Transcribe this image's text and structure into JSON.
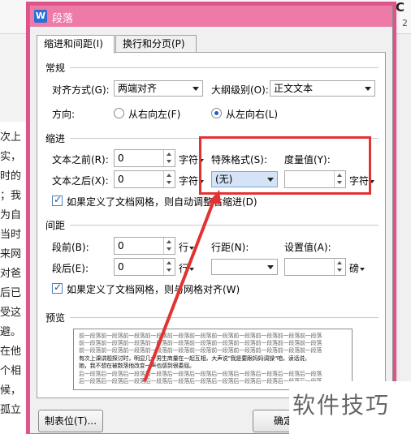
{
  "background": {
    "styles_text": "AaBbC",
    "number": "2",
    "doc_lines": [
      "次上",
      "实，",
      "时的",
      "；我",
      "为自",
      "当时",
      "来网",
      "对爸",
      "后已",
      "受这",
      "避。",
      "在他",
      "个相",
      "候，",
      "孤立"
    ]
  },
  "dialog": {
    "title": "段落",
    "title_icon": "W",
    "tabs": [
      {
        "label": "缩进和间距(I)",
        "active": true
      },
      {
        "label": "换行和分页(P)",
        "active": false
      }
    ],
    "general": {
      "heading": "常规",
      "alignment_label": "对齐方式(G):",
      "alignment_value": "两端对齐",
      "outline_label": "大纲级别(O):",
      "outline_value": "正文文本",
      "direction_label": "方向:",
      "rtl_label": "从右向左(F)",
      "ltr_label": "从左向右(L)",
      "direction_selected": "ltr"
    },
    "indent": {
      "heading": "缩进",
      "before_label": "文本之前(R):",
      "before_value": "0",
      "before_unit": "字符",
      "after_label": "文本之后(X):",
      "after_value": "0",
      "after_unit": "字符",
      "special_label": "特殊格式(S):",
      "special_value": "(无)",
      "measure_label": "度量值(Y):",
      "measure_value": "",
      "measure_unit": "字符",
      "grid_check_label": "如果定义了文档网格，则自动调整右缩进(D)",
      "grid_checked": true
    },
    "spacing": {
      "heading": "间距",
      "before_label": "段前(B):",
      "before_value": "0",
      "before_unit": "行",
      "after_label": "段后(E):",
      "after_value": "0",
      "after_unit": "行",
      "line_label": "行距(N):",
      "line_value": "",
      "setting_label": "设置值(A):",
      "setting_value": "",
      "setting_unit": "磅",
      "grid_check_label": "如果定义了文档网格，则与网格对齐(W)",
      "grid_checked": true
    },
    "preview": {
      "heading": "预览",
      "prev_line": "前一段落前一段落前一段落前一段落前一段落前一段落前一段落前一段落前一段落前一段落前一段落",
      "sample_line_1": "有次上课讲题探讨时，明显几个男生商量在一起互相，大声说\"我是要跟妈妈调操\"咱，读话说，",
      "sample_line_2": "她，我不想在被数落他改变一声也感到很委屈。",
      "next_line": "后一段落后一段落后一段落后一段落后一段落后一段落后一段落后一段落后一段落后一段落后一段落"
    },
    "buttons": {
      "tabs_label": "制表位(T)...",
      "ok_label": "确定"
    }
  },
  "watermark": "软件技巧",
  "colors": {
    "titlebar": "#ee7aa8",
    "highlight": "#e23333",
    "arrow": "#e23333"
  }
}
